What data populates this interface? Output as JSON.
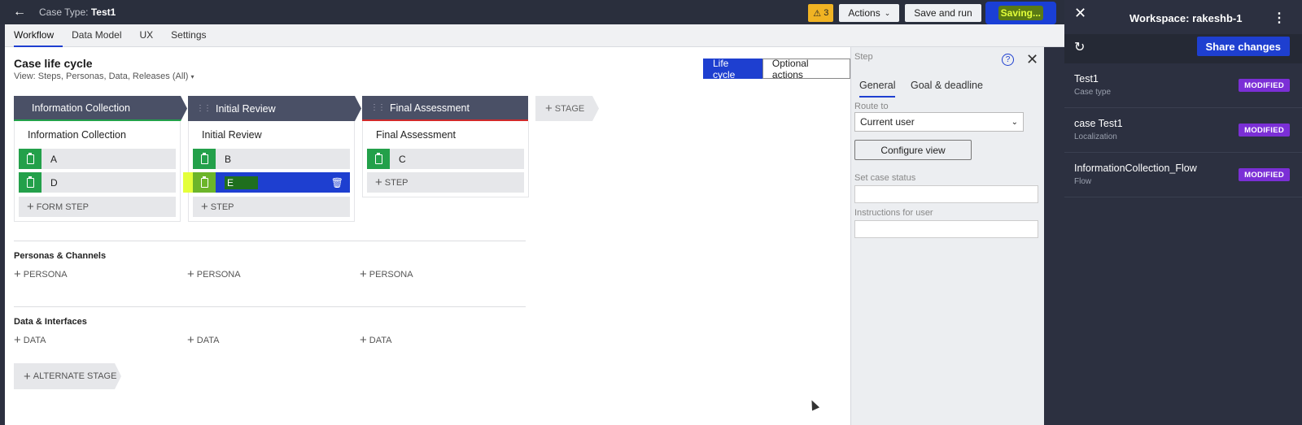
{
  "topbar": {
    "back_icon": "arrow-left-icon",
    "casetype_prefix": "Case Type:",
    "casetype_name": "Test1",
    "warning_count": "3",
    "actions_label": "Actions",
    "save_run_label": "Save and run",
    "saving_label": "Saving..."
  },
  "tabs": [
    {
      "label": "Workflow",
      "active": true
    },
    {
      "label": "Data Model"
    },
    {
      "label": "UX"
    },
    {
      "label": "Settings"
    }
  ],
  "lifecycle": {
    "title": "Case life cycle",
    "view": "View: Steps, Personas, Data, Releases (All)",
    "segments": [
      "Life cycle",
      "Optional actions"
    ],
    "stages": [
      {
        "header": "Information Collection",
        "name": "Information Collection",
        "steps": [
          "A",
          "D"
        ],
        "add_label": "FORM STEP",
        "accent": "#23a04a"
      },
      {
        "header": "Initial Review",
        "name": "Initial Review",
        "steps": [
          "B",
          "E"
        ],
        "add_label": "STEP"
      },
      {
        "header": "Final Assessment",
        "name": "Final Assessment",
        "steps": [
          "C"
        ],
        "add_label": "STEP",
        "accent": "#d02a2a"
      }
    ],
    "add_stage_label": "STAGE",
    "personas_title": "Personas & Channels",
    "persona_label": "PERSONA",
    "data_title": "Data & Interfaces",
    "data_label": "DATA",
    "alternate_stage_label": "ALTERNATE STAGE"
  },
  "step_panel": {
    "title": "Step",
    "tabs": [
      "General",
      "Goal & deadline"
    ],
    "route_label": "Route to",
    "route_value": "Current user",
    "configure_label": "Configure view",
    "set_status_label": "Set case status",
    "instructions_label": "Instructions for user"
  },
  "workspace": {
    "title": "Workspace:  rakeshb-1",
    "share_label": "Share changes",
    "items": [
      {
        "name": "Test1",
        "type": "Case type",
        "badge": "MODIFIED"
      },
      {
        "name": "case Test1",
        "type": "Localization",
        "badge": "MODIFIED"
      },
      {
        "name": "InformationCollection_Flow",
        "type": "Flow",
        "badge": "MODIFIED"
      }
    ]
  },
  "colors": {
    "accent": "#1e3fd0",
    "step_icon": "#23a04a",
    "badge": "#7b2fd6",
    "warning": "#f0b323"
  }
}
